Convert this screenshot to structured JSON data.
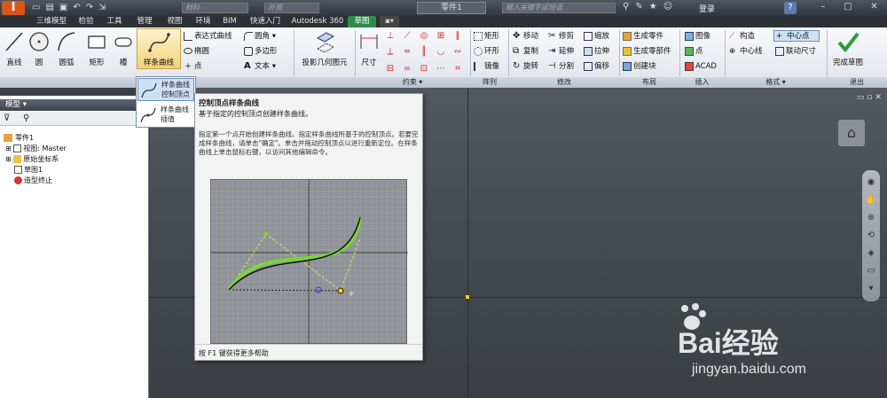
{
  "titlebar": {
    "logo": "I",
    "material_placeholder": "材料",
    "appearance_placeholder": "外观",
    "document_name": "零件1",
    "search_placeholder": "键入关键字或短语",
    "login_label": "登录"
  },
  "tabs": [
    "三维模型",
    "检验",
    "工具",
    "管理",
    "视图",
    "环境",
    "BIM",
    "快速入门",
    "Autodesk 360",
    "草图"
  ],
  "active_tab": "草图",
  "ribbon": {
    "draw": {
      "line": "直线",
      "circle": "圆",
      "arc": "圆弧",
      "rectangle": "矩形",
      "slot": "槽",
      "spline": "样条曲线",
      "equation_curve": "表达式曲线",
      "ellipse": "椭圆",
      "point": "点",
      "fillet": "圆角",
      "polygon": "多边形",
      "text": "文本"
    },
    "project": "投影几何图元",
    "dimension": "尺寸",
    "constraint_label": "约束",
    "pattern": {
      "rect": "矩形",
      "circ": "环形",
      "mirror": "镜像",
      "label": "阵列"
    },
    "modify": {
      "move": "移动",
      "copy": "复制",
      "rotate": "旋转",
      "trim": "修剪",
      "extend": "延伸",
      "split": "分割",
      "scale": "缩放",
      "stretch": "拉伸",
      "offset": "偏移",
      "label": "修改"
    },
    "layout": {
      "make_part": "生成零件",
      "make_components": "生成零部件",
      "create_block": "创建块",
      "label": "布局"
    },
    "insert": {
      "image": "图像",
      "points": "点",
      "acad": "ACAD",
      "label": "插入"
    },
    "format": {
      "construction": "构造",
      "centerpoint": "中心点",
      "centerline": "中心线",
      "driven_dim": "联动尺寸",
      "label": "格式"
    },
    "finish": {
      "label": "完成草图",
      "group": "退出"
    }
  },
  "dropdown": {
    "item1_line1": "样条曲线",
    "item1_line2": "控制顶点",
    "item2_line1": "样条曲线",
    "item2_line2": "插值"
  },
  "model_panel": {
    "title": "模型",
    "tree": [
      "零件1",
      "视图: Master",
      "原始坐标系",
      "草图1",
      "造型终止"
    ]
  },
  "tooltip": {
    "title": "控制顶点样条曲线",
    "subtitle": "基于指定的控制顶点创建样条曲线。",
    "body": "指定第一个点开始创建样条曲线。指定样条曲线所基于的控制顶点。若要完成样条曲线，请单击\"确定\"。单击并拖动控制顶点以进行重新定位。在样条曲线上单击鼠标右键，以访问其他编辑命令。",
    "footer": "按 F1 键获得更多帮助"
  },
  "watermark": {
    "brand": "Bai经验",
    "url": "jingyan.baidu.com"
  },
  "colors": {
    "sketch_tab": "#2e8b4a",
    "spline_preview": "#7ad63a",
    "canvas": "#4a4f55"
  }
}
